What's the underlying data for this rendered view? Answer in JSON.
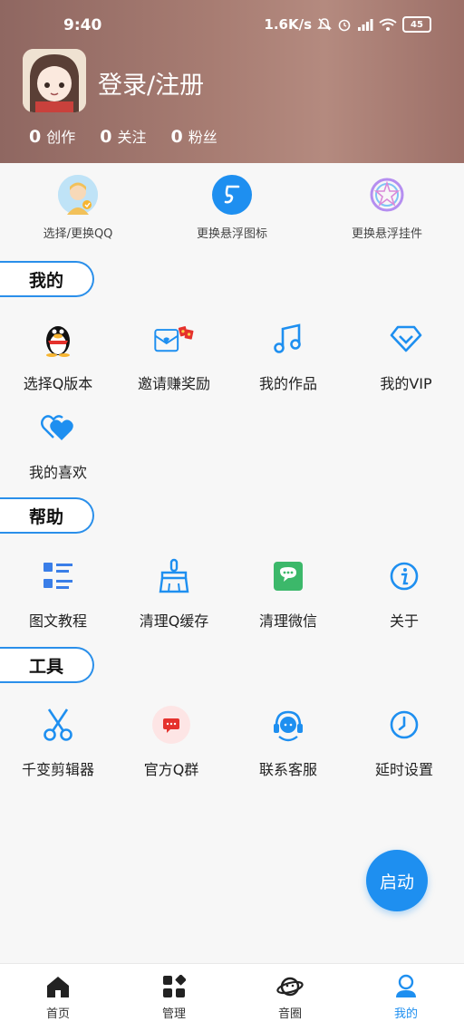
{
  "status": {
    "time": "9:40",
    "speed": "1.6K/s",
    "battery": "45"
  },
  "profile": {
    "login": "登录/注册",
    "stats": [
      {
        "num": "0",
        "label": "创作"
      },
      {
        "num": "0",
        "label": "关注"
      },
      {
        "num": "0",
        "label": "粉丝"
      }
    ]
  },
  "shortcuts": [
    {
      "label": "选择/更换QQ",
      "icon": "qq-avatar-icon"
    },
    {
      "label": "更换悬浮图标",
      "icon": "music-note-icon"
    },
    {
      "label": "更换悬浮挂件",
      "icon": "star-ring-icon"
    }
  ],
  "sections": {
    "mine": {
      "title": "我的",
      "items": [
        {
          "label": "选择Q版本",
          "icon": "penguin-icon"
        },
        {
          "label": "邀请赚奖励",
          "icon": "envelope-icon"
        },
        {
          "label": "我的作品",
          "icon": "music-note-icon"
        },
        {
          "label": "我的VIP",
          "icon": "diamond-icon"
        },
        {
          "label": "我的喜欢",
          "icon": "hearts-icon"
        }
      ]
    },
    "help": {
      "title": "帮助",
      "items": [
        {
          "label": "图文教程",
          "icon": "list-icon"
        },
        {
          "label": "清理Q缓存",
          "icon": "broom-icon"
        },
        {
          "label": "清理微信",
          "icon": "chat-icon"
        },
        {
          "label": "关于",
          "icon": "info-icon"
        }
      ]
    },
    "tools": {
      "title": "工具",
      "items": [
        {
          "label": "千变剪辑器",
          "icon": "scissors-icon"
        },
        {
          "label": "官方Q群",
          "icon": "group-chat-icon"
        },
        {
          "label": "联系客服",
          "icon": "headset-icon"
        },
        {
          "label": "延时设置",
          "icon": "clock-icon"
        }
      ]
    }
  },
  "fab": {
    "label": "启动"
  },
  "nav": [
    {
      "label": "首页",
      "icon": "home-icon"
    },
    {
      "label": "管理",
      "icon": "grid-icon"
    },
    {
      "label": "音圈",
      "icon": "planet-icon"
    },
    {
      "label": "我的",
      "icon": "user-icon"
    }
  ],
  "colors": {
    "accent": "#1e8ff0",
    "header": "#a77c72"
  }
}
